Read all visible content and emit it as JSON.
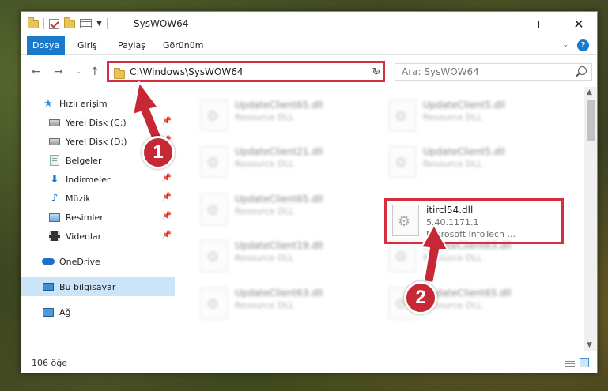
{
  "window": {
    "title": "SysWOW64",
    "controls": {
      "minimize_icon": "minimize-icon",
      "maximize_icon": "maximize-icon",
      "close_icon": "close-icon"
    }
  },
  "ribbon": {
    "tabs": [
      {
        "label": "Dosya",
        "active": true
      },
      {
        "label": "Giriş",
        "active": false
      },
      {
        "label": "Paylaş",
        "active": false
      },
      {
        "label": "Görünüm",
        "active": false
      }
    ],
    "accent_color": "#1979ca"
  },
  "navigation": {
    "back_icon": "back-arrow-icon",
    "forward_icon": "forward-arrow-icon",
    "up_icon": "up-arrow-icon",
    "address": "C:\\Windows\\SysWOW64",
    "search_placeholder": "Ara: SysWOW64"
  },
  "sidebar": {
    "items": [
      {
        "label": "Hızlı erişim",
        "icon": "star-icon",
        "pinned": false
      },
      {
        "label": "Yerel Disk (C:)",
        "icon": "drive-icon",
        "pinned": true
      },
      {
        "label": "Yerel Disk (D:)",
        "icon": "drive-icon",
        "pinned": true
      },
      {
        "label": "Belgeler",
        "icon": "documents-icon",
        "pinned": true
      },
      {
        "label": "İndirmeler",
        "icon": "downloads-icon",
        "pinned": true
      },
      {
        "label": "Müzik",
        "icon": "music-icon",
        "pinned": true
      },
      {
        "label": "Resimler",
        "icon": "pictures-icon",
        "pinned": true
      },
      {
        "label": "Videolar",
        "icon": "videos-icon",
        "pinned": true
      },
      {
        "label": "OneDrive",
        "icon": "onedrive-icon",
        "pinned": false
      },
      {
        "label": "Bu bilgisayar",
        "icon": "computer-icon",
        "pinned": false,
        "selected": true
      },
      {
        "label": "Ağ",
        "icon": "network-icon",
        "pinned": false
      }
    ]
  },
  "files": [
    {
      "name": "UpdateClient65.dll",
      "type": "Resource DLL"
    },
    {
      "name": "UpdateClient5.dll",
      "type": "Resource DLL"
    },
    {
      "name": "UpdateClient21.dll",
      "type": "Resource DLL"
    },
    {
      "name": "UpdateClient5.dll",
      "type": "Resource DLL"
    },
    {
      "name": "UpdateClient65.dll",
      "type": "Resource DLL"
    },
    {
      "name": "itircl54.dll",
      "version": "5.40.1171.1",
      "company": "Microsoft InfoTech ...",
      "highlighted": true
    },
    {
      "name": "UpdateClient19.dll",
      "type": "Resource DLL"
    },
    {
      "name": "UpdateClient63.dll",
      "type": "Resource DLL"
    },
    {
      "name": "UpdateClient63.dll",
      "type": "Resource DLL"
    },
    {
      "name": "UpdateClient65.dll",
      "type": "Resource DLL"
    }
  ],
  "status": {
    "item_count": "106 öğe"
  },
  "annotations": {
    "step1": "1",
    "step2": "2",
    "color": "#c62835"
  }
}
